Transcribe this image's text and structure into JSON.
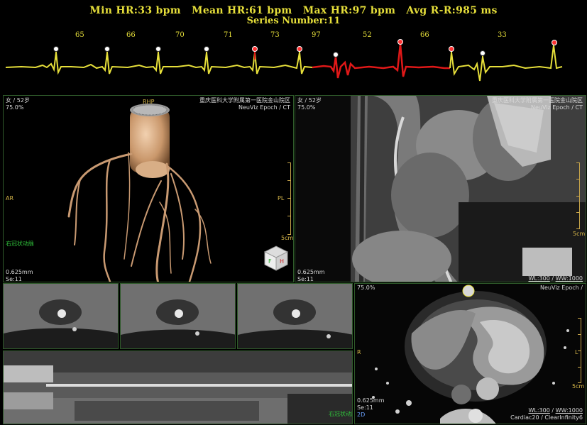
{
  "header": {
    "min_hr": "Min HR:33 bpm",
    "mean_hr": "Mean HR:61 bpm",
    "max_hr": "Max HR:97 bpm",
    "avg_rr": "Avg R-R:985 ms",
    "series_number": "Series Number:11",
    "beat_rates": [
      "65",
      "66",
      "70",
      "71",
      "73",
      "97",
      "52",
      "66",
      "33"
    ]
  },
  "colors": {
    "ecg_normal": "#e6df3a",
    "ecg_selected": "#e01818",
    "accent": "#e6df3a",
    "frame": "#2f5a2a"
  },
  "vr3d": {
    "patient": "女 / 52岁",
    "phase": "75.0%",
    "hospital": "重庆医科大学附属第一医院金山院区",
    "device": "NeuViz Epoch / CT",
    "orient_top": "RHP",
    "orient_left": "AR",
    "orient_right": "PL",
    "vessel_label": "右冠状动脉",
    "thickness": "0.625mm",
    "series": "Se:11",
    "scale": "5cm"
  },
  "cpr": {
    "patient": "女 / 52岁",
    "phase": "75.0%",
    "hospital": "重庆医科大学附属第一医院金山院区",
    "device": "NeuViz Epoch / CT",
    "thickness": "0.625mm",
    "series": "Se:11",
    "scale": "5cm",
    "wl": "WL:300",
    "ww": "WW:1000"
  },
  "axial": {
    "phase": "75.0%",
    "device": "NeuViz Epoch /",
    "orient_left": "R",
    "orient_right": "L",
    "thickness": "0.625mm",
    "series": "Se:11",
    "mode": "2D",
    "scale": "5cm",
    "wl": "WL:300",
    "ww": "WW:1000",
    "protocol": "Cardiac20 / ClearInfinity6"
  },
  "stretched": {
    "vessel_label": "右冠状动脉"
  }
}
